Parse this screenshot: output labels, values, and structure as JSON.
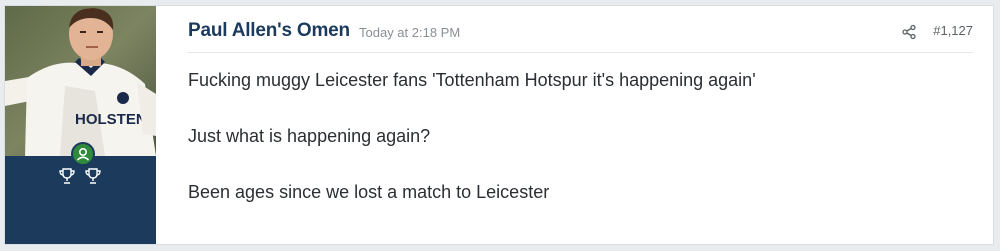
{
  "post": {
    "username": "Paul Allen's Omen",
    "timestamp": "Today at 2:18 PM",
    "post_number": "#1,127",
    "share_icon": "share-icon",
    "message_lines": [
      "Fucking muggy Leicester fans 'Tottenham Hotspur it's happening again'",
      "Just what is happening again?",
      "Been ages since we lost a match to Leicester"
    ]
  },
  "avatar": {
    "shirt_text": "HOLSTEN"
  },
  "user_panel": {
    "trophy_icons": [
      "trophy-icon",
      "trophy-icon"
    ],
    "online_badge_icon": "user-online-icon"
  },
  "colors": {
    "user_panel_bg": "#1b3a5c",
    "username": "#1b3a5c",
    "online_badge": "#2f8a3b",
    "timestamp": "#8a8f95",
    "page_bg": "#e9ecef"
  }
}
